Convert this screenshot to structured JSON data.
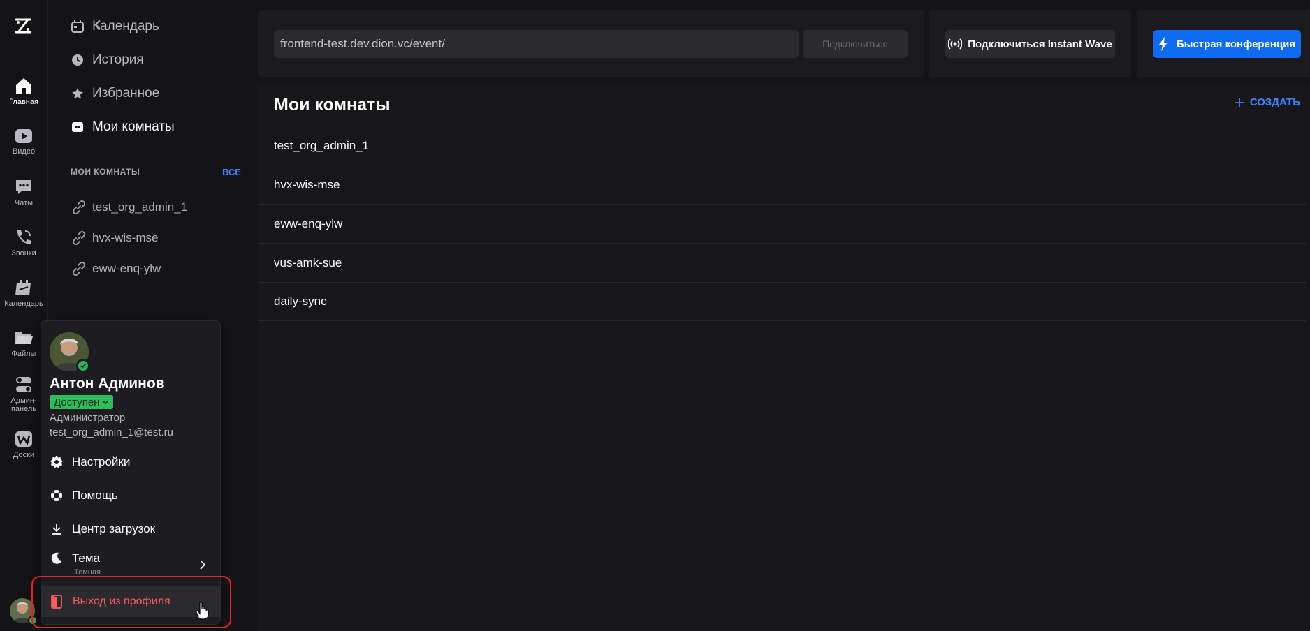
{
  "rail": {
    "items": [
      {
        "label": "Главная",
        "icon": "home-icon",
        "active": true
      },
      {
        "label": "Видео",
        "icon": "video-icon"
      },
      {
        "label": "Чаты",
        "icon": "chat-icon"
      },
      {
        "label": "Звонки",
        "icon": "phone-icon"
      },
      {
        "label": "Календарь",
        "icon": "calendar-icon"
      },
      {
        "label": "Файлы",
        "icon": "folder-icon"
      },
      {
        "label_line1": "Админ-",
        "label_line2": "панель",
        "icon": "admin-icon"
      },
      {
        "label": "Доски",
        "icon": "boards-icon"
      }
    ]
  },
  "nav": {
    "items": [
      {
        "label": "Календарь",
        "icon": "calendar-icon"
      },
      {
        "label": "История",
        "icon": "clock-icon"
      },
      {
        "label": "Избранное",
        "icon": "star-icon"
      },
      {
        "label": "Мои комнаты",
        "icon": "camera-icon",
        "active": true
      }
    ],
    "section_title": "МОИ КОМНАТЫ",
    "section_all": "ВСЕ",
    "rooms": [
      "test_org_admin_1",
      "hvx-wis-mse",
      "eww-enq-ylw"
    ]
  },
  "topbar": {
    "url_value": "frontend-test.dev.dion.vc/event/",
    "connect_label": "Подключиться",
    "wave_label": "Подключиться Instant Wave",
    "quick_label": "Быстрая конференция"
  },
  "main": {
    "title": "Мои комнаты",
    "create_label": "СОЗДАТЬ",
    "rooms": [
      "test_org_admin_1",
      "hvx-wis-mse",
      "eww-enq-ylw",
      "vus-amk-sue",
      "daily-sync"
    ]
  },
  "profile": {
    "name": "Антон Админов",
    "status": "Доступен",
    "role": "Администратор",
    "email": "test_org_admin_1@test.ru",
    "menu": {
      "settings": "Настройки",
      "help": "Помощь",
      "downloads": "Центр загрузок",
      "theme": "Тема",
      "theme_value": "Темная",
      "logout": "Выход из профиля"
    }
  },
  "colors": {
    "background": "#141417",
    "panel": "#1b1b1f",
    "accent": "#0f6cf2",
    "link": "#3d82ff",
    "status_green": "#2dbd5c",
    "danger": "#ff5c5c",
    "highlight": "#e3232b"
  }
}
